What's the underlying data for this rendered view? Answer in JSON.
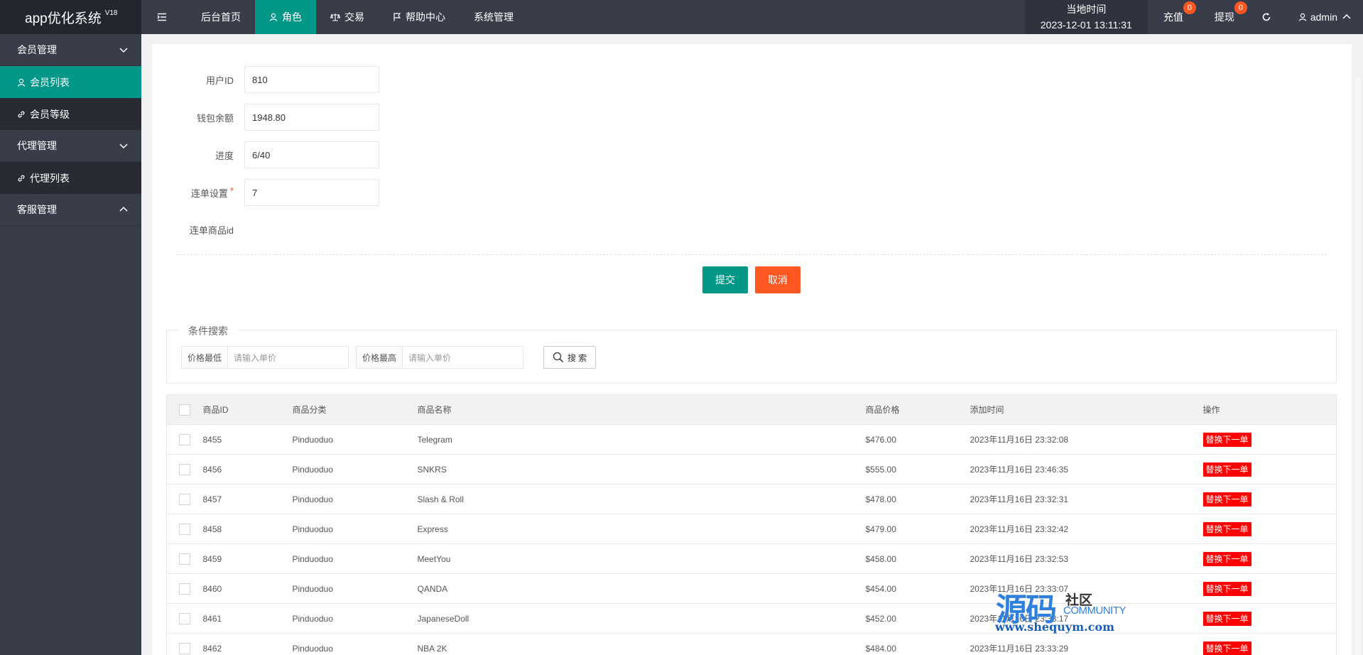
{
  "app": {
    "title": "app优化系统",
    "version": "V18"
  },
  "sidebar": {
    "groups": [
      {
        "label": "会员管理",
        "items": [
          {
            "label": "会员列表",
            "active": true
          },
          {
            "label": "会员等级",
            "active": false
          }
        ]
      },
      {
        "label": "代理管理",
        "items": [
          {
            "label": "代理列表",
            "active": false
          }
        ]
      },
      {
        "label": "客服管理",
        "items": []
      }
    ]
  },
  "topnav": {
    "items": [
      "后台首页",
      "角色",
      "交易",
      "帮助中心",
      "系统管理"
    ],
    "active_index": 1,
    "clock_label": "当地时间",
    "clock_value": "2023-12-01 13:11:31",
    "recharge_label": "充值",
    "recharge_badge": "0",
    "withdraw_label": "提现",
    "withdraw_badge": "0",
    "user": "admin"
  },
  "form": {
    "user_id_label": "用户ID",
    "user_id_value": "810",
    "balance_label": "钱包余额",
    "balance_value": "1948.80",
    "progress_label": "进度",
    "progress_value": "6/40",
    "combo_label": "连单设置",
    "combo_required": "*",
    "combo_value": "7",
    "combo_goods_label": "连单商品id",
    "submit_label": "提交",
    "cancel_label": "取消"
  },
  "search": {
    "legend": "条件搜索",
    "min_label": "价格最低",
    "min_placeholder": "请输入单价",
    "max_label": "价格最高",
    "max_placeholder": "请输入单价",
    "button_label": "搜 索"
  },
  "table": {
    "headers": [
      "商品ID",
      "商品分类",
      "商品名称",
      "商品价格",
      "添加时间",
      "操作"
    ],
    "action_label": "替换下一单",
    "rows": [
      [
        "8455",
        "Pinduoduo",
        "Telegram",
        "$476.00",
        "2023年11月16日 23:32:08"
      ],
      [
        "8456",
        "Pinduoduo",
        "SNKRS",
        "$555.00",
        "2023年11月16日 23:46:35"
      ],
      [
        "8457",
        "Pinduoduo",
        "Slash & Roll",
        "$478.00",
        "2023年11月16日 23:32:31"
      ],
      [
        "8458",
        "Pinduoduo",
        "Express",
        "$479.00",
        "2023年11月16日 23:32:42"
      ],
      [
        "8459",
        "Pinduoduo",
        "MeetYou",
        "$458.00",
        "2023年11月16日 23:32:53"
      ],
      [
        "8460",
        "Pinduoduo",
        "QANDA",
        "$454.00",
        "2023年11月16日 23:33:07"
      ],
      [
        "8461",
        "Pinduoduo",
        "JapaneseDoll",
        "$452.00",
        "2023年11月16日 23:33:17"
      ],
      [
        "8462",
        "Pinduoduo",
        "NBA 2K",
        "$484.00",
        "2023年11月16日 23:33:29"
      ]
    ]
  },
  "watermark": {
    "main": "源码",
    "sub": "社区",
    "community": "COMMUNITY",
    "url": "www.shequym.com"
  },
  "colors": {
    "accent": "#009688",
    "danger": "#FF5722",
    "action": "#FF0000",
    "dark": "#393D49"
  }
}
